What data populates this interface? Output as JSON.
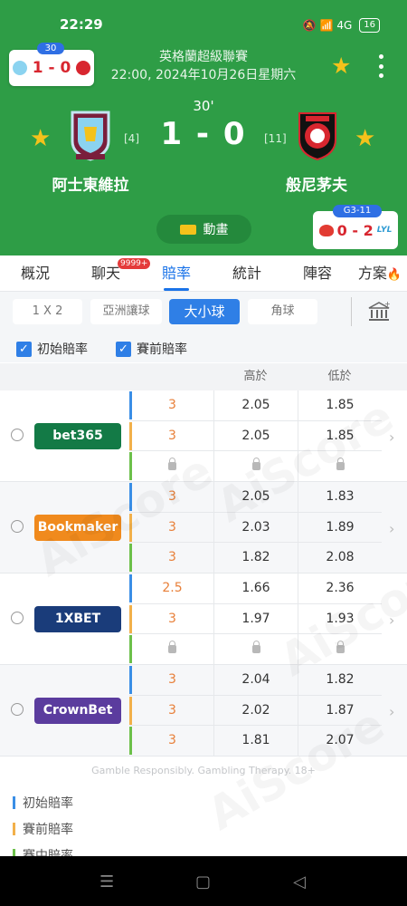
{
  "status_bar": {
    "time": "22:29",
    "icons": "🔕 📶 4G",
    "battery": "16"
  },
  "mini_score": {
    "minute": "30",
    "score": "1 - 0"
  },
  "match": {
    "league": "英格蘭超級聯賽",
    "datetime": "22:00, 2024年10月26日星期六",
    "minute": "30'",
    "score": "1 - 0",
    "home": {
      "name": "阿士東維拉",
      "rank": "[4]"
    },
    "away": {
      "name": "般尼茅夫",
      "rank": "[11]"
    }
  },
  "animation_button": "動畫",
  "promo": {
    "badge": "G3-11",
    "score": "0 - 2",
    "logo_text": "LYL"
  },
  "tabs": [
    {
      "label": "概況"
    },
    {
      "label": "聊天",
      "badge": "9999+"
    },
    {
      "label": "賠率",
      "active": true
    },
    {
      "label": "統計"
    },
    {
      "label": "陣容"
    },
    {
      "label": "方案"
    }
  ],
  "markets": [
    "1 X 2",
    "亞洲讓球",
    "大小球",
    "角球"
  ],
  "active_market": "大小球",
  "checkboxes": {
    "initial": "初始賠率",
    "pregame": "賽前賠率"
  },
  "columns": {
    "over": "高於",
    "under": "低於"
  },
  "bookmakers": [
    {
      "name": "bet365",
      "color": "#137a46",
      "rows": [
        [
          "3",
          "2.05",
          "1.85"
        ],
        [
          "3",
          "2.05",
          "1.85"
        ],
        [
          "lock",
          "lock",
          "lock"
        ]
      ]
    },
    {
      "name": "Bookmaker",
      "color": "#f08a1d",
      "rows": [
        [
          "3",
          "2.05",
          "1.83"
        ],
        [
          "3",
          "2.03",
          "1.89"
        ],
        [
          "3",
          "1.82",
          "2.08"
        ]
      ]
    },
    {
      "name": "1XBET",
      "color": "#1a3c7a",
      "rows": [
        [
          "2.5",
          "1.66",
          "2.36"
        ],
        [
          "3",
          "1.97",
          "1.93"
        ],
        [
          "lock",
          "lock",
          "lock"
        ]
      ]
    },
    {
      "name": "CrownBet",
      "color": "#5b3c9e",
      "rows": [
        [
          "3",
          "2.04",
          "1.82"
        ],
        [
          "3",
          "2.02",
          "1.87"
        ],
        [
          "3",
          "1.81",
          "2.07"
        ]
      ]
    }
  ],
  "row_bar_colors": [
    "#3a8ee6",
    "#f2b04a",
    "#6cc04a"
  ],
  "disclaimer": "Gamble Responsibly. Gambling Therapy. 18+",
  "legend": [
    "初始賠率",
    "賽前賠率",
    "賽中賠率"
  ],
  "watermark": "AiScore",
  "colors": {
    "header_green": "#2e9d46",
    "accent_blue": "#1a73e8",
    "score_red": "#d8262f",
    "star_gold": "#f4c21b"
  }
}
